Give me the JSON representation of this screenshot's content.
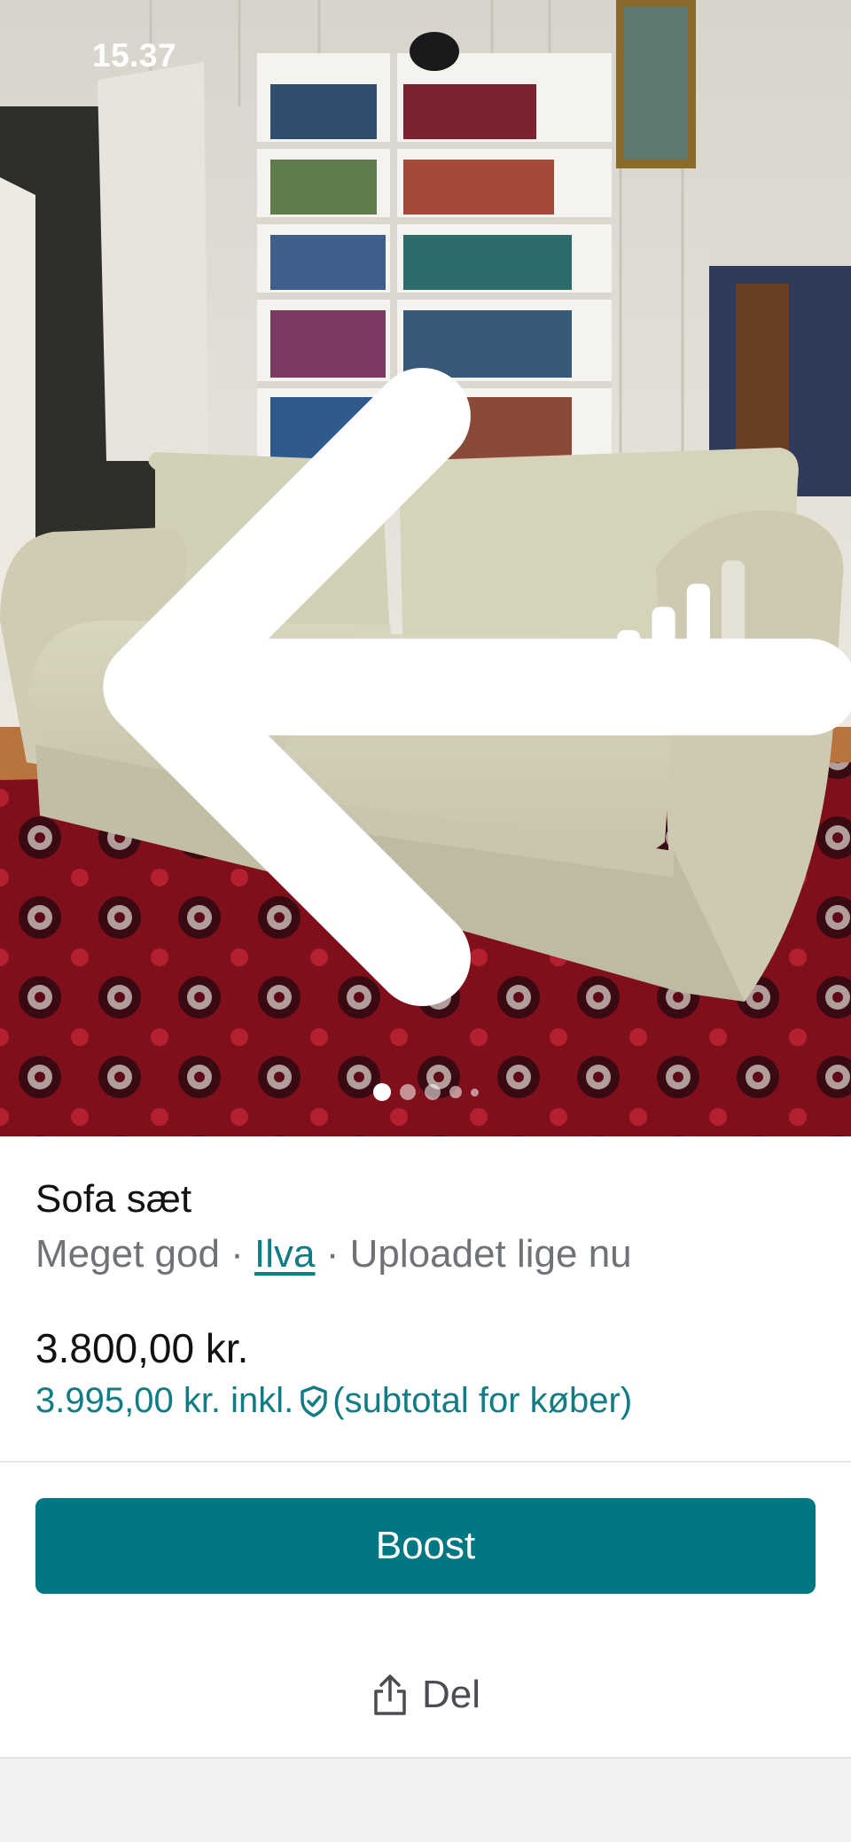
{
  "status_bar": {
    "time": "15.37"
  },
  "navigation": {
    "back_icon": "arrow-left-icon"
  },
  "gallery": {
    "total_images": 5,
    "active_index": 0,
    "photo_subject": "sofa-photo"
  },
  "listing": {
    "title": "Sofa sæt",
    "condition": "Meget god",
    "separator": " · ",
    "brand": "Ilva",
    "uploaded": "Uploadet lige nu",
    "price": "3.800,00 kr.",
    "buyer_price": "3.995,00 kr. inkl.",
    "buyer_price_note": "(subtotal for køber)",
    "protection_icon": "shield-check-icon"
  },
  "actions": {
    "boost_label": "Boost",
    "share_label": "Del",
    "share_icon": "share-icon"
  },
  "colors": {
    "accent": "#007782",
    "link": "#127c84",
    "muted_text": "#6f7377"
  }
}
